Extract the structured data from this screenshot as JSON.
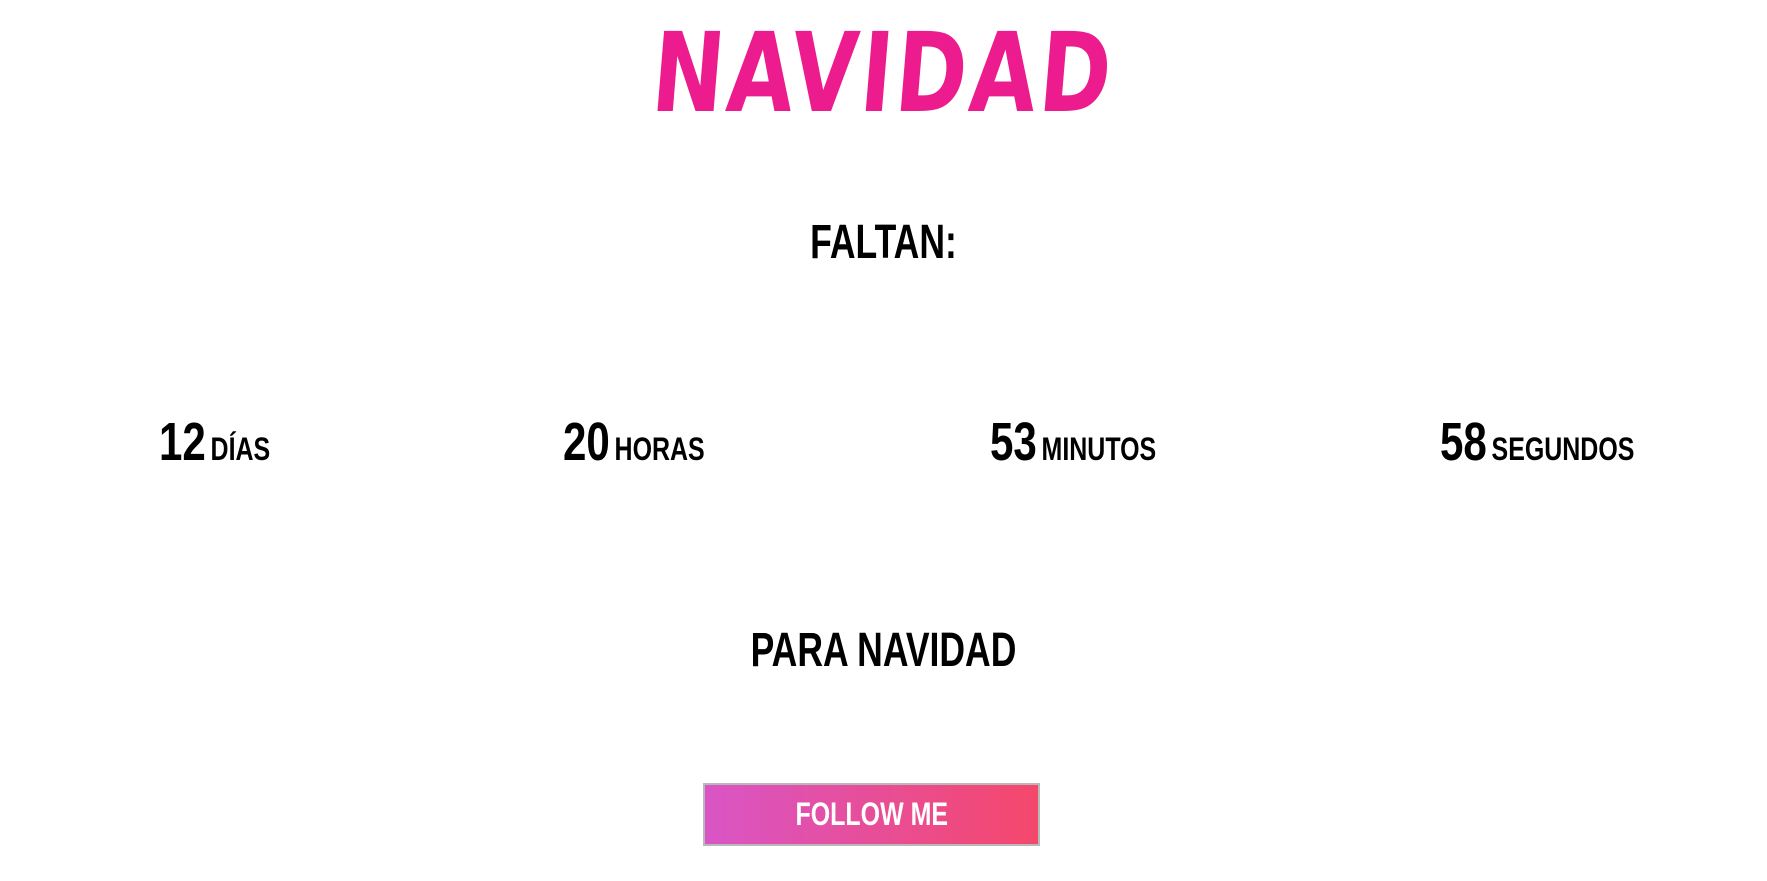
{
  "header": {
    "title": "NAVIDAD",
    "title_color": "#ec1c8e"
  },
  "intro": {
    "label": "FALTAN:"
  },
  "countdown": [
    {
      "value": "12",
      "unit": "DÍAS"
    },
    {
      "value": "20",
      "unit": "HORAS"
    },
    {
      "value": "53",
      "unit": "MINUTOS"
    },
    {
      "value": "58",
      "unit": "SEGUNDOS"
    }
  ],
  "outro": {
    "label": "PARA NAVIDAD"
  },
  "button": {
    "label": "FOLLOW ME",
    "gradient_start": "#d955c6",
    "gradient_end": "#f5476b",
    "text_color": "#ffffff"
  }
}
